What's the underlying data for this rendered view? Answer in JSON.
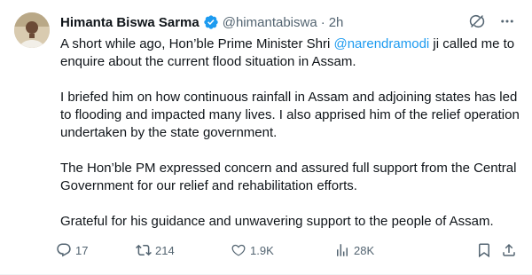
{
  "author": {
    "name": "Himanta Biswa Sarma",
    "handle": "@himantabiswa",
    "separator": "·",
    "time": "2h",
    "verified_color": "#1d9bf0"
  },
  "tweet": {
    "p1_before": "A short while ago, Hon’ble Prime Minister Shri ",
    "p1_mention": "@narendramodi",
    "p1_after": " ji called me to enquire about the current flood situation in Assam.",
    "p2": "I briefed him on how continuous rainfall in Assam and adjoining states has led to flooding and impacted many lives. I also apprised him of the relief operation undertaken by the state government.",
    "p3": "The Hon’ble PM expressed concern and assured full support from the Central Government for our relief and rehabilitation efforts.",
    "p4": "Grateful for his guidance and unwavering support to the people of Assam."
  },
  "actions": {
    "replies": "17",
    "retweets": "214",
    "likes": "1.9K",
    "views": "28K"
  },
  "icons": {
    "top": [
      "grok-icon",
      "more-icon"
    ],
    "actions": [
      "reply-icon",
      "retweet-icon",
      "like-icon",
      "views-icon",
      "bookmark-icon",
      "share-icon"
    ]
  },
  "colors": {
    "text": "#0f1419",
    "muted": "#536471",
    "link": "#1d9bf0"
  }
}
